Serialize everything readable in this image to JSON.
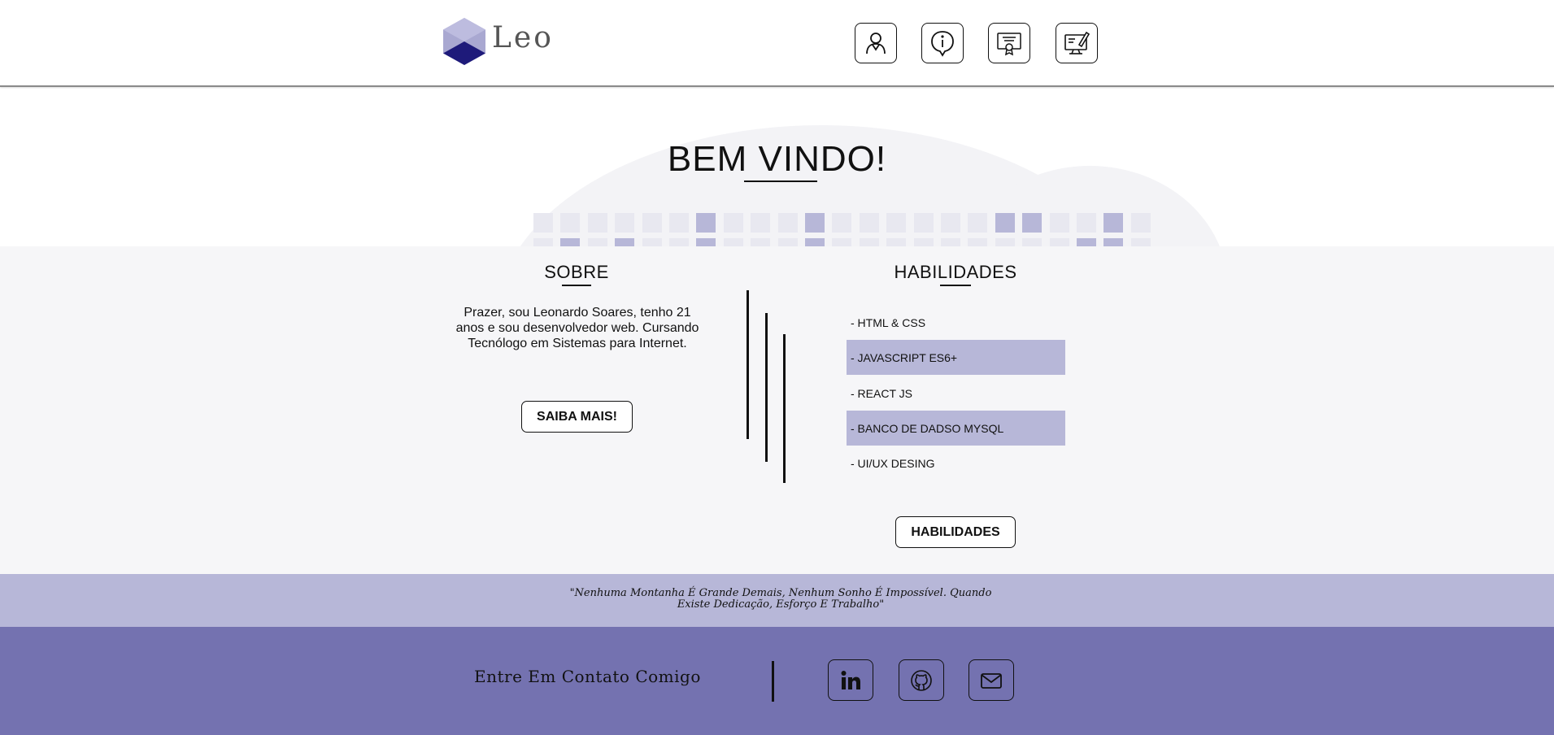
{
  "header": {
    "brand": "Leo",
    "nav": [
      {
        "name": "perfil",
        "icon": "user-icon"
      },
      {
        "name": "sobre",
        "icon": "info-icon"
      },
      {
        "name": "certificados",
        "icon": "certificate-icon"
      },
      {
        "name": "projetos",
        "icon": "monitor-pen-icon"
      }
    ]
  },
  "hero": {
    "title": "BEM VINDO!"
  },
  "about": {
    "title": "SOBRE",
    "text": "Prazer, sou Leonardo Soares, tenho 21 anos e sou desenvolvedor web. Cursando Tecnólogo em Sistemas para Internet.",
    "button_label": "SAIBA MAIS!"
  },
  "skills": {
    "title": "HABILIDADES",
    "items": [
      {
        "label": "- HTML & CSS",
        "highlighted": false
      },
      {
        "label": "- JAVASCRIPT ES6+",
        "highlighted": true
      },
      {
        "label": "- REACT JS",
        "highlighted": false
      },
      {
        "label": "- BANCO DE DADSO MYSQL",
        "highlighted": true
      },
      {
        "label": "- UI/UX DESING",
        "highlighted": false
      }
    ],
    "button_label": "HABILIDADES"
  },
  "quote": {
    "line1": "\"Nenhuma Montanha É Grande Demais, Nenhum Sonho É Impossível. Quando",
    "line2": "Existe Dedicação, Esforço E Trabalho\""
  },
  "footer": {
    "contact_label": "Entre Em Contato Comigo",
    "social": [
      {
        "name": "linkedin",
        "icon": "linkedin-icon"
      },
      {
        "name": "github",
        "icon": "github-icon"
      },
      {
        "name": "email",
        "icon": "mail-icon"
      }
    ]
  },
  "colors": {
    "accent_light": "#b7b7d8",
    "accent_dark": "#7472b0",
    "logo_dark": "#1e1a7a",
    "section_bg": "#f6f6f8"
  }
}
